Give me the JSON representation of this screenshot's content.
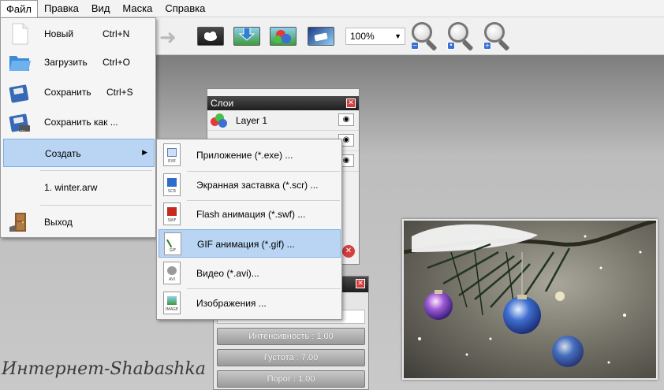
{
  "menubar": {
    "items": [
      "Файл",
      "Правка",
      "Вид",
      "Маска",
      "Справка"
    ]
  },
  "toolbar": {
    "zoom_value": "100%",
    "zoom_buttons": [
      "zoom-out",
      "zoom-fit",
      "zoom-in"
    ]
  },
  "file_menu": {
    "items": [
      {
        "label": "Новый",
        "shortcut": "Ctrl+N",
        "icon": "new-document-icon"
      },
      {
        "label": "Загрузить",
        "shortcut": "Ctrl+O",
        "icon": "open-folder-icon"
      },
      {
        "label": "Сохранить",
        "shortcut": "Ctrl+S",
        "icon": "save-floppy-icon"
      },
      {
        "label": "Сохранить как ...",
        "shortcut": "",
        "icon": "save-as-floppy-icon"
      },
      {
        "label": "Создать",
        "shortcut": "",
        "icon": "",
        "has_submenu": true
      },
      {
        "label": "1. winter.arw",
        "shortcut": "",
        "icon": ""
      },
      {
        "label": "Выход",
        "shortcut": "",
        "icon": "exit-door-icon"
      }
    ]
  },
  "create_submenu": {
    "items": [
      {
        "label": "Приложение (*.exe) ...",
        "tag": "EXE"
      },
      {
        "label": "Экранная заставка (*.scr) ...",
        "tag": "SCR"
      },
      {
        "label": "Flash анимация (*.swf) ...",
        "tag": "SWF"
      },
      {
        "label": "GIF анимация (*.gif) ...",
        "tag": "GIF"
      },
      {
        "label": "Видео (*.avi)...",
        "tag": "AVI"
      },
      {
        "label": "Изображения ...",
        "tag": "IMAGE"
      }
    ]
  },
  "layers_panel": {
    "title": "Слои",
    "layers": [
      {
        "name": "Layer 1"
      }
    ]
  },
  "effects_panel": {
    "sliders": [
      {
        "label": "Интенсивность : 1.00"
      },
      {
        "label": "Густота : 7.00"
      },
      {
        "label": "Порог : 1.00"
      }
    ]
  },
  "watermark": "Интернет-Shabashka",
  "colors": {
    "highlight": "#b9d5f3",
    "highlight_border": "#7ab0e6",
    "panel_title": "#1e1e1e",
    "close_red": "#d24040"
  }
}
